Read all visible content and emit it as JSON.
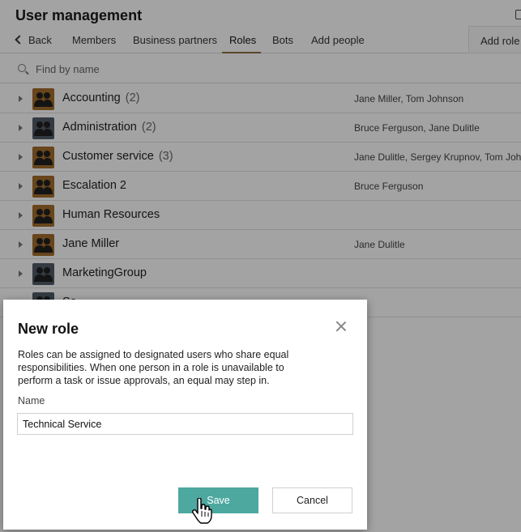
{
  "app": {
    "title": "User management"
  },
  "nav": {
    "back_label": "Back",
    "tabs": [
      {
        "label": "Members"
      },
      {
        "label": "Business partners"
      },
      {
        "label": "Roles",
        "active": true
      },
      {
        "label": "Bots"
      },
      {
        "label": "Add people"
      }
    ],
    "add_role_label": "Add role"
  },
  "search": {
    "placeholder": "Find by name",
    "value": ""
  },
  "roles": [
    {
      "name": "Accounting",
      "count": "(2)",
      "members": "Jane Miller, Tom Johnson",
      "avatar_color": "#a06a2a"
    },
    {
      "name": "Administration",
      "count": "(2)",
      "members": "Bruce Ferguson, Jane Dulitle",
      "avatar_color": "#505a66"
    },
    {
      "name": "Customer service",
      "count": "(3)",
      "members": "Jane Dulitle, Sergey Krupnov, Tom Joh",
      "avatar_color": "#a06a2a"
    },
    {
      "name": "Escalation 2",
      "count": "",
      "members": "Bruce Ferguson",
      "avatar_color": "#a06a2a"
    },
    {
      "name": "Human Resources",
      "count": "",
      "members": "",
      "avatar_color": "#a06a2a"
    },
    {
      "name": "Jane Miller",
      "count": "",
      "members": "Jane Dulitle",
      "avatar_color": "#a06a2a"
    },
    {
      "name": "MarketingGroup",
      "count": "",
      "members": "",
      "avatar_color": "#505a66"
    },
    {
      "name": "Sa",
      "count": "",
      "members": "",
      "avatar_color": "#505a66"
    }
  ],
  "dialog": {
    "title": "New role",
    "description": "Roles can be assigned to designated users who share equal responsibilities. When one person in a role is unavailable to perform a task or issue approvals, an equal may step in.",
    "name_label": "Name",
    "name_value": "Technical Service",
    "save_label": "Save",
    "cancel_label": "Cancel"
  },
  "colors": {
    "save_button": "#4da8a0",
    "tab_underline": "#8a6d3b"
  }
}
